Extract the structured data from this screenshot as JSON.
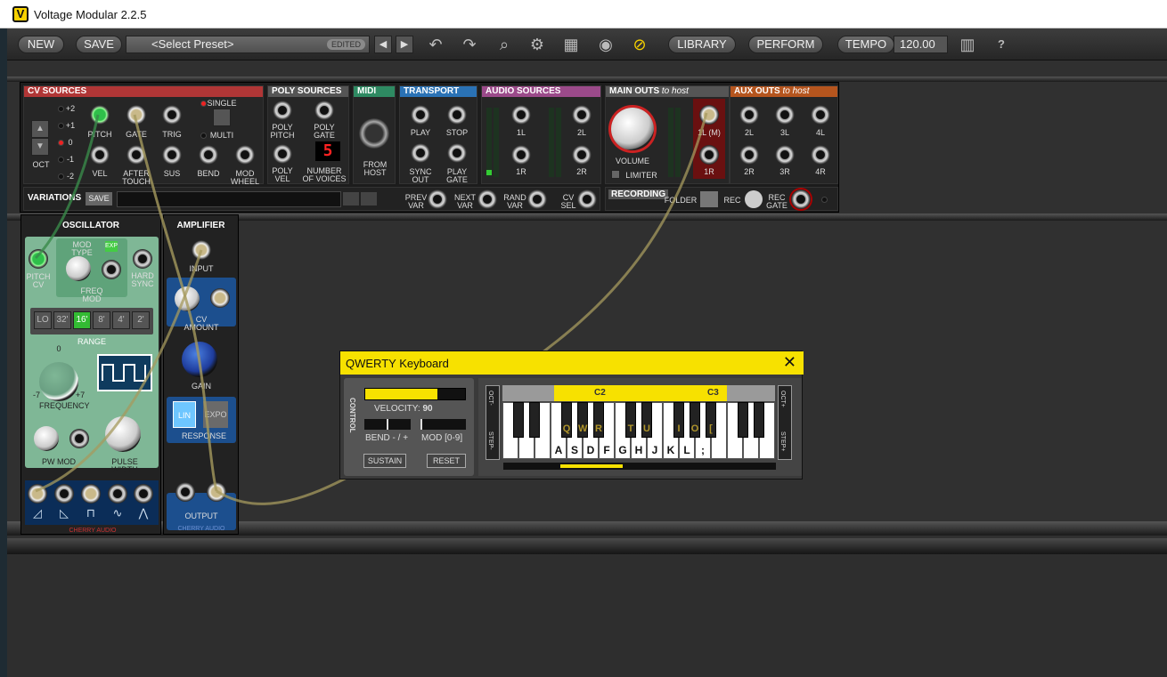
{
  "window": {
    "title": "Voltage Modular 2.2.5",
    "logo_letter": "V"
  },
  "toolbar": {
    "new": "NEW",
    "save": "SAVE",
    "preset": "<Select Preset>",
    "edited": "EDITED",
    "library": "LIBRARY",
    "perform": "PERFORM",
    "tempo_label": "TEMPO",
    "tempo_value": "120.00",
    "help": "?"
  },
  "io": {
    "cv_sources": "CV SOURCES",
    "oct_label": "OCT",
    "oct_levels": [
      "+2",
      "+1",
      "0",
      "-1",
      "-2"
    ],
    "single": "SINGLE",
    "multi": "MULTI",
    "pitch": "PITCH",
    "gate": "GATE",
    "trig": "TRIG",
    "vel": "VEL",
    "aftertouch": "AFTER\nTOUCH",
    "sus": "SUS",
    "bend": "BEND",
    "modwheel": "MOD\nWHEEL",
    "poly_sources": "POLY SOURCES",
    "poly_pitch": "POLY\nPITCH",
    "poly_gate": "POLY\nGATE",
    "poly_vel": "POLY\nVEL",
    "voices_display": "5",
    "number_of_voices": "NUMBER\nOF VOICES",
    "midi": "MIDI",
    "from_host": "FROM\nHOST",
    "transport": "TRANSPORT",
    "play": "PLAY",
    "stop": "STOP",
    "sync_out": "SYNC\nOUT",
    "play_gate": "PLAY\nGATE",
    "audio_sources": "AUDIO SOURCES",
    "a1l": "1L",
    "a1r": "1R",
    "a2l": "2L",
    "a2r": "2R",
    "main_outs": "MAIN OUTS",
    "to_host": "to host",
    "volume": "VOLUME",
    "limiter": "LIMITER",
    "m1l": "1L (M)",
    "m1r": "1R",
    "aux_outs": "AUX OUTS",
    "aux": [
      "2L",
      "3L",
      "4L",
      "2R",
      "3R",
      "4R"
    ],
    "variations": "VARIATIONS",
    "var_save": "SAVE",
    "prev_var": "PREV\nVAR",
    "next_var": "NEXT\nVAR",
    "rand_var": "RAND\nVAR",
    "cv_sel": "CV\nSEL",
    "recording": "RECORDING",
    "folder": "FOLDER",
    "rec": "REC",
    "rec_gate": "REC\nGATE"
  },
  "oscillator": {
    "title": "OSCILLATOR",
    "mod_type": "MOD TYPE",
    "exp": "EXP",
    "pitch_cv": "PITCH\nCV",
    "freq_mod": "FREQ MOD",
    "hard_sync": "HARD\nSYNC",
    "range": [
      "LO",
      "32'",
      "16'",
      "8'",
      "4'",
      "2'"
    ],
    "range_label": "RANGE",
    "zero": "0",
    "minus7": "-7",
    "plus7": "+7",
    "frequency": "FREQUENCY",
    "pw_mod": "PW MOD",
    "pulse_width": "PULSE WIDTH",
    "brand": "CHERRY AUDIO"
  },
  "amplifier": {
    "title": "AMPLIFIER",
    "input": "INPUT",
    "cv_amount": "CV AMOUNT",
    "gain": "GAIN",
    "lin": "LIN",
    "expo": "EXPO",
    "response": "RESPONSE",
    "output": "OUTPUT",
    "brand": "CHERRY AUDIO"
  },
  "qwerty": {
    "title": "QWERTY Keyboard",
    "control": "CONTROL",
    "velocity": "VELOCITY:",
    "velocity_value": "90",
    "velocity_level": 0.72,
    "bend": "BEND - / +",
    "mod": "MOD [0-9]",
    "sustain": "SUSTAIN",
    "reset": "RESET",
    "oct_minus": "OCT-",
    "oct_plus": "OCT+",
    "step_minus": "STEP-",
    "step_plus": "STEP+",
    "c2": "C2",
    "c3": "C3",
    "black_keys": [
      "Q",
      "W",
      "R",
      "T",
      "U",
      "I",
      "O",
      "["
    ],
    "white_keys": [
      "A",
      "S",
      "D",
      "F",
      "G",
      "H",
      "J",
      "K",
      "L",
      ";"
    ]
  }
}
